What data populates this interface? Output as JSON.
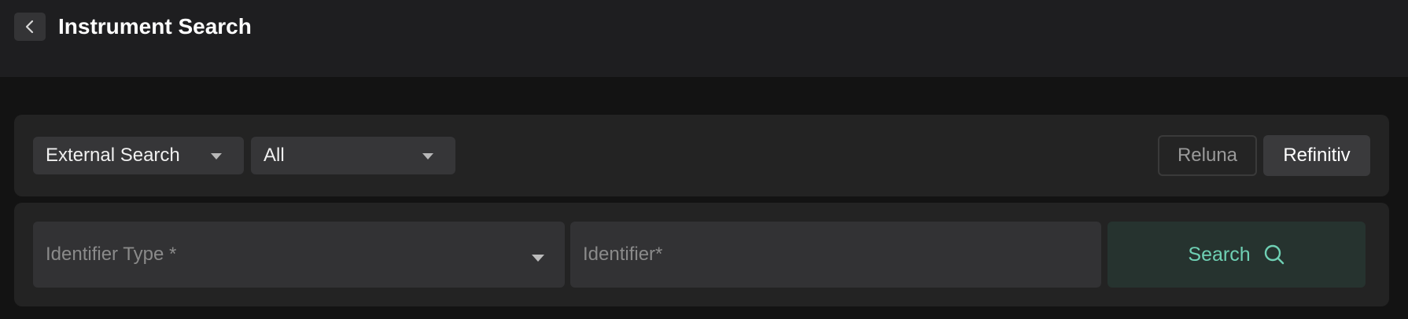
{
  "header": {
    "title": "Instrument Search",
    "back_icon": "chevron-left-icon"
  },
  "filters": {
    "source_select": {
      "value": "External Search"
    },
    "scope_select": {
      "value": "All"
    },
    "providers": [
      {
        "label": "Reluna",
        "active": false
      },
      {
        "label": "Refinitiv",
        "active": true
      }
    ]
  },
  "search_form": {
    "identifier_type": {
      "placeholder": "Identifier Type *"
    },
    "identifier": {
      "placeholder": "Identifier*"
    },
    "search_button": {
      "label": "Search",
      "icon": "search-icon"
    }
  },
  "colors": {
    "accent": "#6fd0b4",
    "search_button_bg": "#26332f",
    "background": "#131313",
    "panel": "#232323",
    "topbar": "#1e1e20"
  }
}
